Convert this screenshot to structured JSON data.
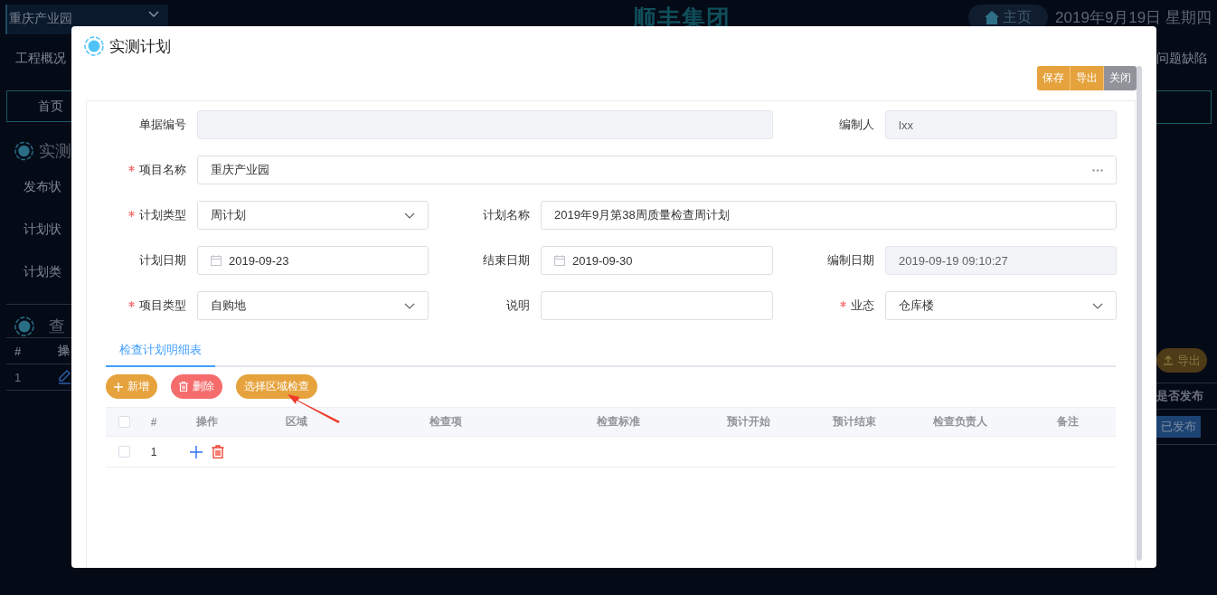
{
  "background": {
    "project_select": "重庆产业园",
    "logo": "顺丰集团",
    "home_button": "主页",
    "date": "2019年9月19日 星期四",
    "nav_left": "工程概况",
    "nav_right": "问题缺陷",
    "tab": "首页",
    "section_title": "实测",
    "filters": [
      "发布状",
      "计划状",
      "计划类"
    ],
    "query_title": "查",
    "export_button": "导出",
    "table_columns": [
      "#",
      "操"
    ],
    "right_column": "是否发布",
    "row_number": "1",
    "status_badge": "已发布"
  },
  "dialog": {
    "title": "实测计划",
    "toolbar": [
      {
        "label": "保存",
        "kind": "primary"
      },
      {
        "label": "导出",
        "kind": "primary"
      },
      {
        "label": "关闭",
        "kind": "neutral"
      }
    ],
    "form": [
      [
        {
          "label": "单据编号",
          "required": false,
          "kind": "text",
          "disabled": true,
          "wide": true
        },
        {
          "label": "编制人",
          "required": false,
          "kind": "text",
          "disabled": true,
          "wide": false,
          "value": "lxx"
        }
      ],
      [
        {
          "label": "项目名称",
          "required": true,
          "kind": "lookup",
          "disabled": false,
          "wide": true,
          "value": "重庆产业园"
        }
      ],
      [
        {
          "label": "计划类型",
          "required": true,
          "kind": "select",
          "disabled": false,
          "wide": false,
          "value": "周计划"
        },
        {
          "label": "计划名称",
          "required": false,
          "kind": "text",
          "disabled": false,
          "wide": true,
          "value": "2019年9月第38周质量检查周计划"
        }
      ],
      [
        {
          "label": "计划日期",
          "required": false,
          "kind": "date",
          "disabled": false,
          "wide": false,
          "value": "2019-09-23"
        },
        {
          "label": "结束日期",
          "required": false,
          "kind": "date",
          "disabled": false,
          "wide": false,
          "value": "2019-09-30"
        },
        {
          "label": "编制日期",
          "required": false,
          "kind": "text",
          "disabled": true,
          "wide": false,
          "value": "2019-09-19 09:10:27"
        }
      ],
      [
        {
          "label": "项目类型",
          "required": true,
          "kind": "select",
          "disabled": false,
          "wide": false,
          "value": "自购地"
        },
        {
          "label": "说明",
          "required": false,
          "kind": "text",
          "disabled": false,
          "wide": false
        },
        {
          "label": "业态",
          "required": true,
          "kind": "select",
          "disabled": false,
          "wide": false,
          "value": "仓库楼"
        }
      ]
    ],
    "tabs": [
      {
        "label": "检查计划明细表",
        "selected": true
      }
    ],
    "actions": [
      {
        "label": "新增",
        "kind": "add"
      },
      {
        "label": "删除",
        "kind": "delete"
      },
      {
        "label": "选择区域检查",
        "kind": "select"
      }
    ],
    "table": {
      "select_all": {
        "checked": false
      },
      "columns": [
        "#",
        "操作",
        "区域",
        "检查项",
        "检查标准",
        "预计开始",
        "预计结束",
        "检查负责人",
        "备注"
      ],
      "rows": [
        {
          "checked": false,
          "number": "1"
        }
      ]
    }
  }
}
